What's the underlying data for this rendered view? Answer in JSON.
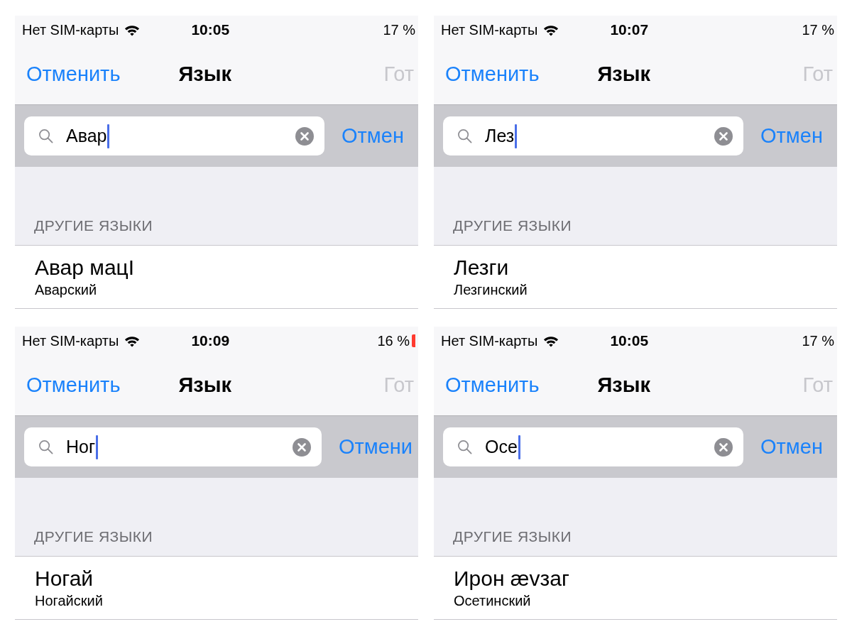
{
  "screens": [
    {
      "status_bar": {
        "carrier": "Нет SIM-карты",
        "time": "10:05",
        "battery": "17 %",
        "battery_low": false
      },
      "nav_bar": {
        "cancel": "Отменить",
        "title": "Язык",
        "done": {
          "label": "Гот",
          "disabled": true
        }
      },
      "search": {
        "value": "Авар",
        "focused": true,
        "cancel": "Отмен"
      },
      "section": {
        "header": "ДРУГИЕ ЯЗЫКИ",
        "rows": [
          {
            "title": "Авар мацӀ",
            "subtitle": "Аварский"
          }
        ]
      }
    },
    {
      "status_bar": {
        "carrier": "Нет SIM-карты",
        "time": "10:07",
        "battery": "17 %",
        "battery_low": false
      },
      "nav_bar": {
        "cancel": "Отменить",
        "title": "Язык",
        "done": {
          "label": "Гот",
          "disabled": true
        }
      },
      "search": {
        "value": "Лез",
        "focused": true,
        "cancel": "Отмен"
      },
      "section": {
        "header": "ДРУГИЕ ЯЗЫКИ",
        "rows": [
          {
            "title": "Лезги",
            "subtitle": "Лезгинский"
          }
        ]
      }
    },
    {
      "status_bar": {
        "carrier": "Нет SIM-карты",
        "time": "10:09",
        "battery": "16 %",
        "battery_low": true
      },
      "nav_bar": {
        "cancel": "Отменить",
        "title": "Язык",
        "done": {
          "label": "Гот",
          "disabled": true
        }
      },
      "search": {
        "value": "Ног",
        "focused": true,
        "cancel": "Отмени"
      },
      "section": {
        "header": "ДРУГИЕ ЯЗЫКИ",
        "rows": [
          {
            "title": "Ногай",
            "subtitle": "Ногайский"
          }
        ]
      }
    },
    {
      "status_bar": {
        "carrier": "Нет SIM-карты",
        "time": "10:05",
        "battery": "17 %",
        "battery_low": false
      },
      "nav_bar": {
        "cancel": "Отменить",
        "title": "Язык",
        "done": {
          "label": "Гот",
          "disabled": true
        }
      },
      "search": {
        "value": "Осе",
        "focused": true,
        "cancel": "Отмен"
      },
      "section": {
        "header": "ДРУГИЕ ЯЗЫКИ",
        "rows": [
          {
            "title": "Ирон ævзаг",
            "subtitle": "Осетинский"
          }
        ]
      }
    }
  ]
}
